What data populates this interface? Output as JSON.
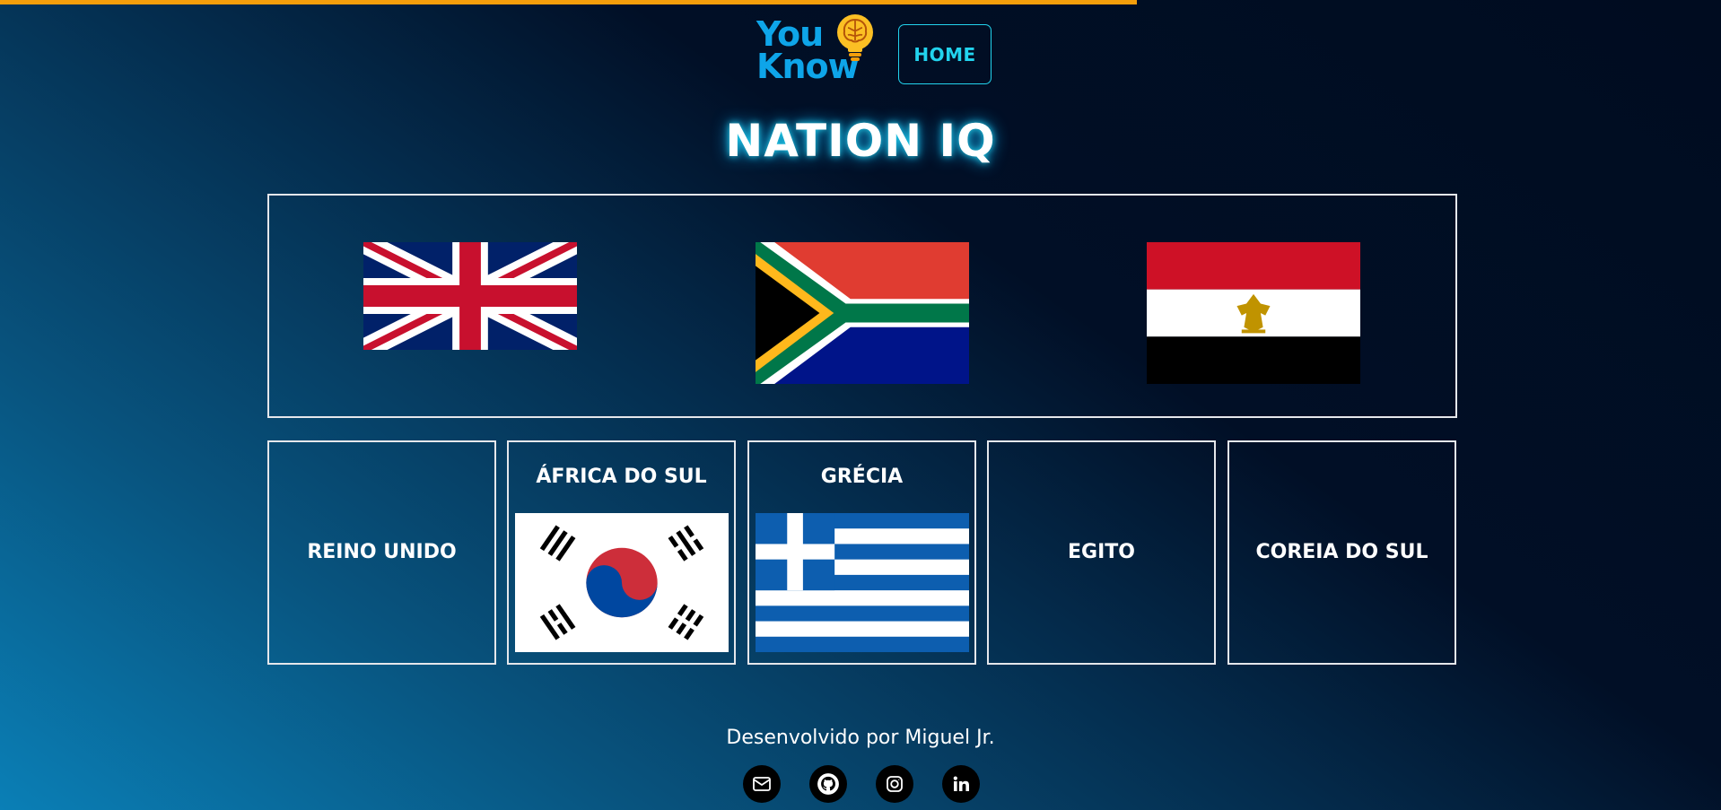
{
  "header": {
    "logo": {
      "line1": "You",
      "line2": "Know"
    },
    "home_label": "HOME"
  },
  "page_title": "NATION IQ",
  "flag_board": {
    "flags": [
      "united-kingdom-flag",
      "south-africa-flag",
      "egypt-flag"
    ]
  },
  "answers": [
    {
      "label": "REINO UNIDO",
      "dropped_flag": null
    },
    {
      "label": "ÁFRICA DO SUL",
      "dropped_flag": "south-korea-flag"
    },
    {
      "label": "GRÉCIA",
      "dropped_flag": "greece-flag"
    },
    {
      "label": "EGITO",
      "dropped_flag": null
    },
    {
      "label": "COREIA DO SUL",
      "dropped_flag": null
    }
  ],
  "footer": {
    "credit": "Desenvolvido por Miguel Jr.",
    "socials": [
      "mail-icon",
      "github-icon",
      "instagram-icon",
      "linkedin-icon"
    ]
  },
  "colors": {
    "accent": "#22d3ee",
    "progress": "#f59e0b",
    "logo_blue": "#0ea5e9",
    "bulb": "#fbbf24"
  }
}
